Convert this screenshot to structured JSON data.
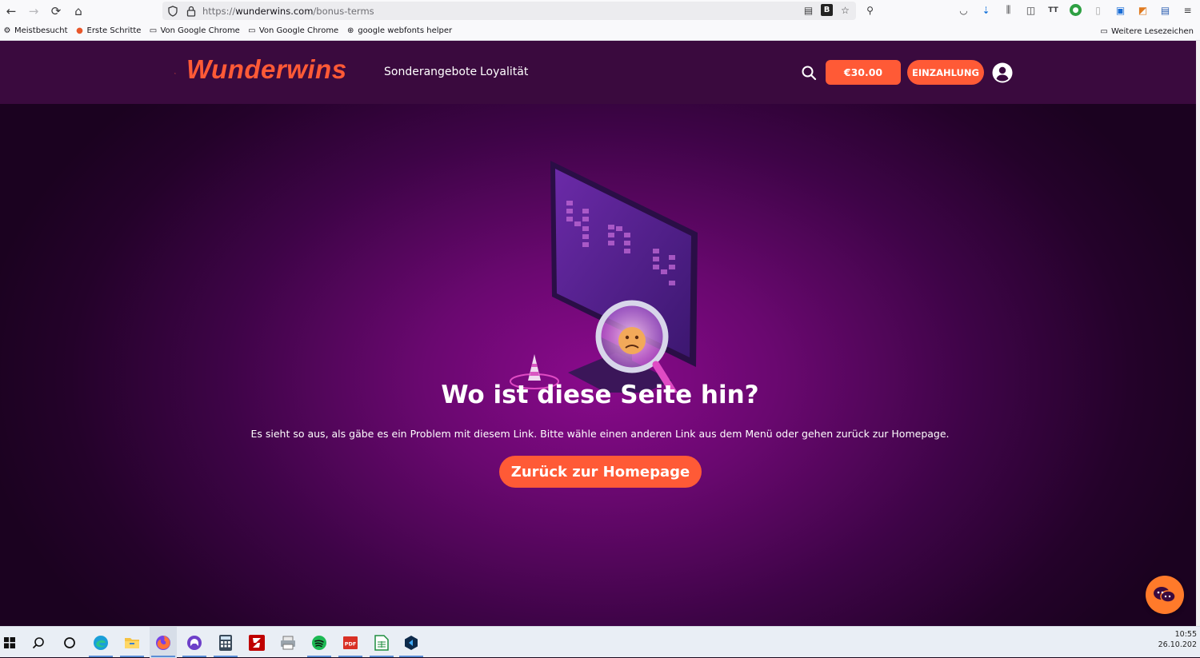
{
  "browser": {
    "url_prefix": "https://",
    "url_host": "wunderwins.com",
    "url_path": "/bonus-terms",
    "bookmarks": [
      {
        "label": "Meistbesucht",
        "icon": "gear-icon"
      },
      {
        "label": "Erste Schritte",
        "icon": "firefox-icon"
      },
      {
        "label": "Von Google Chrome",
        "icon": "folder-icon"
      },
      {
        "label": "Von Google Chrome",
        "icon": "folder-icon"
      },
      {
        "label": "google webfonts helper",
        "icon": "globe-icon"
      }
    ],
    "other_bookmarks": "Weitere Lesezeichen"
  },
  "site": {
    "logo": "Wunderwins",
    "nav": [
      "Sonderangebote",
      "Loyalität"
    ],
    "balance": "€30.00",
    "deposit": "EINZAHLUNG",
    "error": {
      "title": "Wo ist diese Seite hin?",
      "message": "Es sieht so aus, als gäbe es ein Problem mit diesem Link. Bitte wähle einen anderen Link aus dem Menü oder gehen zurück zur Homepage.",
      "button": "Zurück zur Homepage"
    },
    "colors": {
      "accent": "#ff5a36",
      "header": "#3a0a3e",
      "chat": "#ff7a2a"
    }
  },
  "taskbar": {
    "apps": [
      "start-icon",
      "search-icon",
      "cortana-icon",
      "edge-icon",
      "file-explorer-icon",
      "firefox-icon",
      "github-desktop-icon",
      "calculator-icon",
      "filezilla-icon",
      "printer-icon",
      "spotify-icon",
      "pdf-icon",
      "spreadsheet-icon",
      "vscode-icon"
    ],
    "time": "10:55",
    "date": "26.10.202"
  }
}
